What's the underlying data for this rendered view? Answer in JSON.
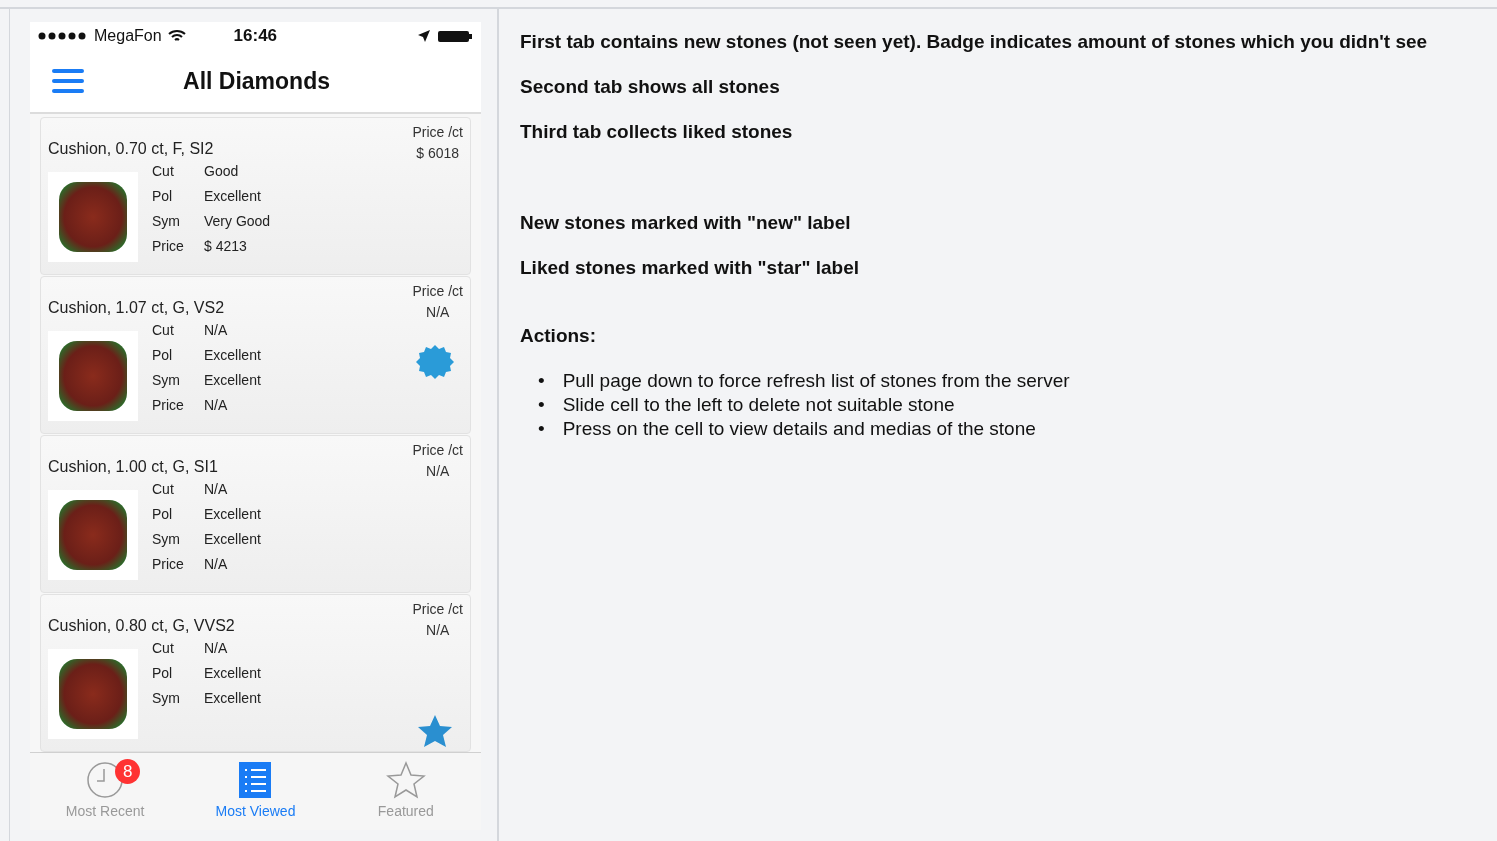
{
  "status_bar": {
    "carrier": "MegaFon",
    "time": "16:46"
  },
  "nav": {
    "title": "All Diamonds"
  },
  "stones": [
    {
      "title": "Cushion, 0.70 ct, F, SI2",
      "price_label": "Price /ct",
      "price_per_ct": "$ 6018",
      "specs": [
        {
          "label": "Cut",
          "value": "Good"
        },
        {
          "label": "Pol",
          "value": "Excellent"
        },
        {
          "label": "Sym",
          "value": "Very Good"
        },
        {
          "label": "Price",
          "value": "$ 4213"
        }
      ],
      "kind": "plain"
    },
    {
      "title": "Cushion, 1.07 ct, G, VS2",
      "price_label": "Price /ct",
      "price_per_ct": "N/A",
      "specs": [
        {
          "label": "Cut",
          "value": "N/A"
        },
        {
          "label": "Pol",
          "value": "Excellent"
        },
        {
          "label": "Sym",
          "value": "Excellent"
        },
        {
          "label": "Price",
          "value": "N/A"
        }
      ],
      "kind": "new"
    },
    {
      "title": "Cushion, 1.00 ct, G, SI1",
      "price_label": "Price /ct",
      "price_per_ct": "N/A",
      "specs": [
        {
          "label": "Cut",
          "value": "N/A"
        },
        {
          "label": "Pol",
          "value": "Excellent"
        },
        {
          "label": "Sym",
          "value": "Excellent"
        },
        {
          "label": "Price",
          "value": "N/A"
        }
      ],
      "kind": "plain"
    },
    {
      "title": "Cushion, 0.80 ct, G, VVS2",
      "price_label": "Price /ct",
      "price_per_ct": "N/A",
      "specs": [
        {
          "label": "Cut",
          "value": "N/A"
        },
        {
          "label": "Pol",
          "value": "Excellent"
        },
        {
          "label": "Sym",
          "value": "Excellent"
        }
      ],
      "kind": "star"
    }
  ],
  "tabs": [
    {
      "label": "Most Recent",
      "selected": false,
      "badge": "8"
    },
    {
      "label": "Most Viewed",
      "selected": true
    },
    {
      "label": "Featured",
      "selected": false
    }
  ],
  "tab_notes": [
    "First tab contains new stones (not seen yet). Badge indicates amount of stones which you didn't see",
    "Second tab shows all stones",
    "Third tab collects liked stones"
  ],
  "marker_notes": [
    "New stones marked with \"new\" label",
    "Liked stones marked with \"star\" label"
  ],
  "actions_title": "Actions:",
  "actions": [
    {
      "bullet": "•",
      "text": "Pull page down to force refresh list of stones from the server"
    },
    {
      "bullet": "•",
      "text": "Slide cell to the left to delete not suitable stone"
    },
    {
      "bullet": "•",
      "text": "Press on the cell to view details and medias of the stone"
    }
  ]
}
